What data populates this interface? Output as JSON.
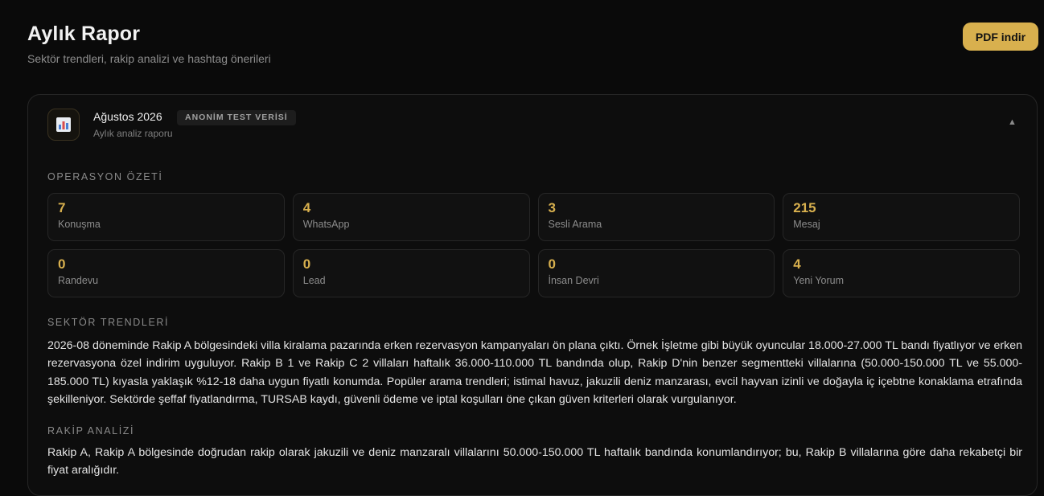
{
  "header": {
    "title": "Aylık Rapor",
    "subtitle": "Sektör trendleri, rakip analizi ve hashtag önerileri",
    "pdf_label": "PDF indir"
  },
  "report": {
    "title": "Ağustos 2026",
    "badge": "ANONİM TEST VERİSİ",
    "subtitle": "Aylık analiz raporu",
    "icon": "bar-chart-icon",
    "collapse_icon": "▲"
  },
  "ops": {
    "heading": "OPERASYON ÖZETİ",
    "stats": [
      {
        "value": "7",
        "label": "Konuşma"
      },
      {
        "value": "4",
        "label": "WhatsApp"
      },
      {
        "value": "3",
        "label": "Sesli Arama"
      },
      {
        "value": "215",
        "label": "Mesaj"
      },
      {
        "value": "0",
        "label": "Randevu"
      },
      {
        "value": "0",
        "label": "Lead"
      },
      {
        "value": "0",
        "label": "İnsan Devri"
      },
      {
        "value": "4",
        "label": "Yeni Yorum"
      }
    ]
  },
  "trends": {
    "heading": "SEKTÖR TRENDLERİ",
    "text": "2026-08 döneminde Rakip A bölgesindeki villa kiralama pazarında erken rezervasyon kampanyaları ön plana çıktı. Örnek İşletme gibi büyük oyuncular 18.000-27.000 TL bandı fiyatlıyor ve erken rezervasyona özel indirim uyguluyor. Rakip B 1 ve Rakip C 2 villaları haftalık 36.000-110.000 TL bandında olup, Rakip D'nin benzer segmentteki villalarına (50.000-150.000 TL ve 55.000-185.000 TL) kıyasla yaklaşık %12-18 daha uygun fiyatlı konumda. Popüler arama trendleri; istimal havuz, jakuzili deniz manzarası, evcil hayvan izinli ve doğayla iç içebtne konaklama etrafında şekilleniyor. Sektörde şeffaf fiyatlandırma, TURSAB kaydı, güvenli ödeme ve iptal koşulları öne çıkan güven kriterleri olarak vurgulanıyor."
  },
  "competitors": {
    "heading": "RAKİP ANALİZİ",
    "text": "Rakip A, Rakip A bölgesinde doğrudan rakip olarak jakuzili ve deniz manzaralı villalarını 50.000-150.000 TL haftalık bandında konumlandırıyor; bu, Rakip B villalarına göre daha rekabetçi bir fiyat aralığıdır."
  },
  "colors": {
    "accent": "#d8b04e",
    "background": "#0a0a0a"
  }
}
